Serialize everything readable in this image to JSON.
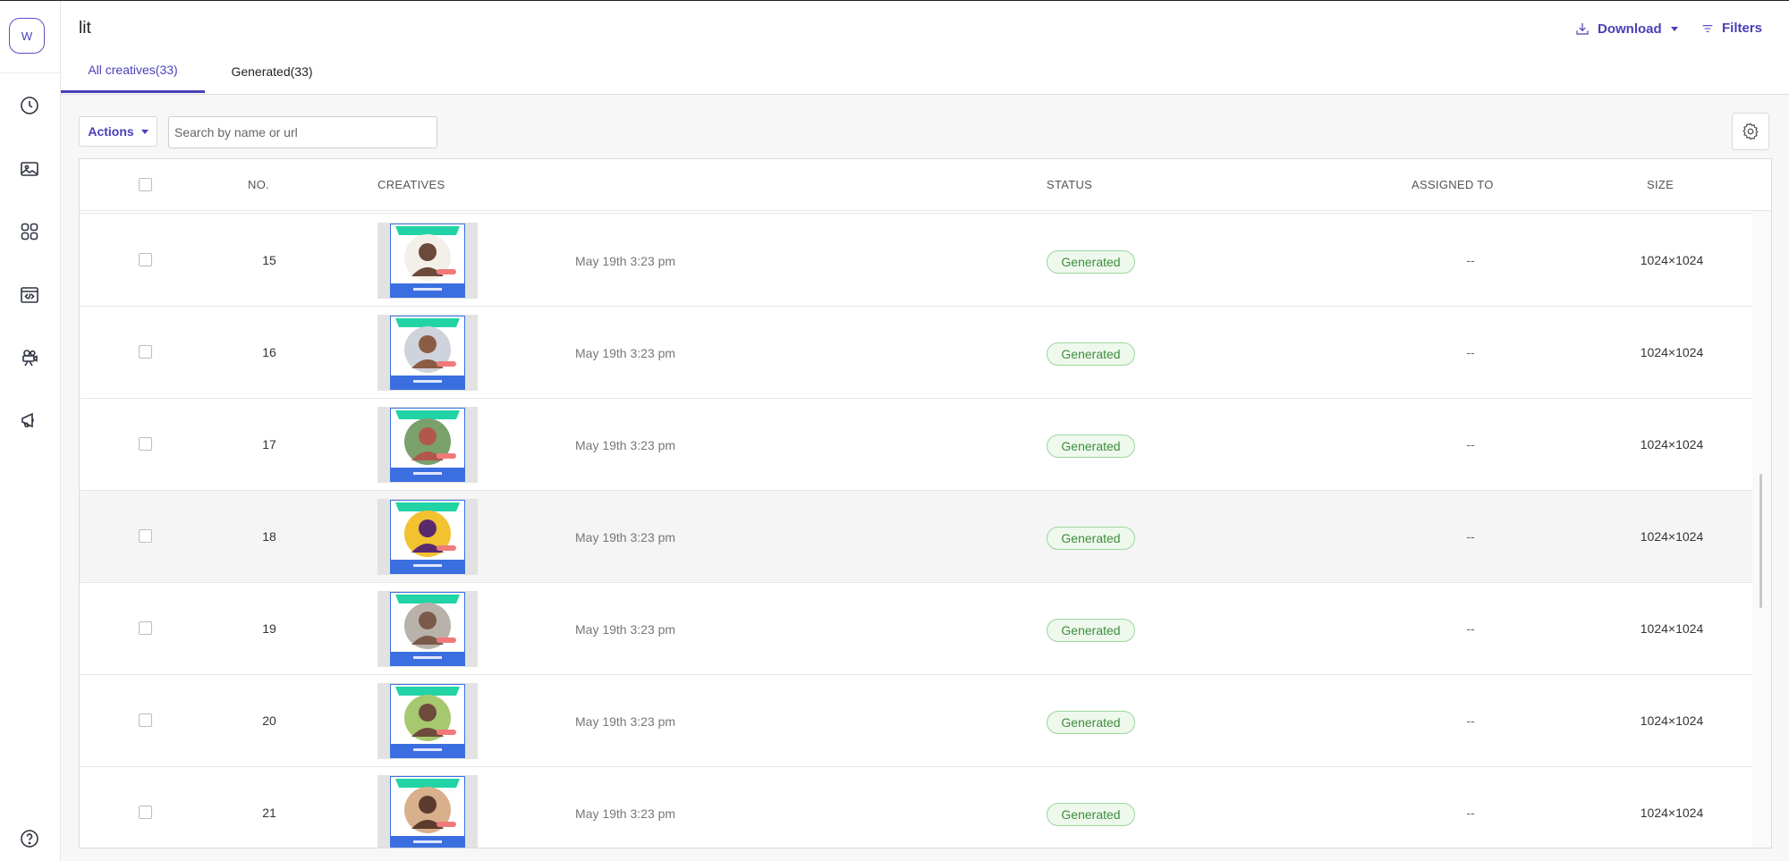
{
  "workspace": {
    "initial": "W"
  },
  "sidebar": {
    "items": [
      {
        "icon": "clock-icon",
        "label": "History"
      },
      {
        "icon": "image-icon",
        "label": "Images"
      },
      {
        "icon": "grid-icon",
        "label": "Templates"
      },
      {
        "icon": "code-icon",
        "label": "Embed"
      },
      {
        "icon": "film-camera-icon",
        "label": "Videos"
      },
      {
        "icon": "megaphone-icon",
        "label": "Campaigns"
      }
    ],
    "help_icon": "help-icon"
  },
  "header": {
    "title": "lit",
    "download_label": "Download",
    "filters_label": "Filters"
  },
  "tabs": [
    {
      "label": "All creatives(33)",
      "active": true
    },
    {
      "label": "Generated(33)",
      "active": false
    }
  ],
  "toolbar": {
    "actions_label": "Actions",
    "search_placeholder": "Search by name or url"
  },
  "table": {
    "columns": [
      "NO.",
      "CREATIVES",
      "STATUS",
      "ASSIGNED TO",
      "SIZE"
    ],
    "rows": [
      {
        "no": "15",
        "date": "May 19th 3:23 pm",
        "status": "Generated",
        "assigned": "--",
        "size": "1024×1024",
        "skin": "#6b4a3a",
        "bg": "#f3f0ea"
      },
      {
        "no": "16",
        "date": "May 19th 3:23 pm",
        "status": "Generated",
        "assigned": "--",
        "size": "1024×1024",
        "skin": "#8a5c44",
        "bg": "#cfd3dc"
      },
      {
        "no": "17",
        "date": "May 19th 3:23 pm",
        "status": "Generated",
        "assigned": "--",
        "size": "1024×1024",
        "skin": "#b0584d",
        "bg": "#7aa06b"
      },
      {
        "no": "18",
        "date": "May 19th 3:23 pm",
        "status": "Generated",
        "assigned": "--",
        "size": "1024×1024",
        "skin": "#5a2a6e",
        "bg": "#f2c230"
      },
      {
        "no": "19",
        "date": "May 19th 3:23 pm",
        "status": "Generated",
        "assigned": "--",
        "size": "1024×1024",
        "skin": "#7c5a4a",
        "bg": "#b9b2ab"
      },
      {
        "no": "20",
        "date": "May 19th 3:23 pm",
        "status": "Generated",
        "assigned": "--",
        "size": "1024×1024",
        "skin": "#6e4b3c",
        "bg": "#a6c96f"
      },
      {
        "no": "21",
        "date": "May 19th 3:23 pm",
        "status": "Generated",
        "assigned": "--",
        "size": "1024×1024",
        "skin": "#5c3a2e",
        "bg": "#d8b08c"
      }
    ]
  },
  "colors": {
    "accent": "#4a3fb8",
    "status_generated_bg": "#eef8ec",
    "status_generated_text": "#3e8e3e",
    "creative_teal": "#22d3a5",
    "creative_blue": "#3b6fe0"
  }
}
